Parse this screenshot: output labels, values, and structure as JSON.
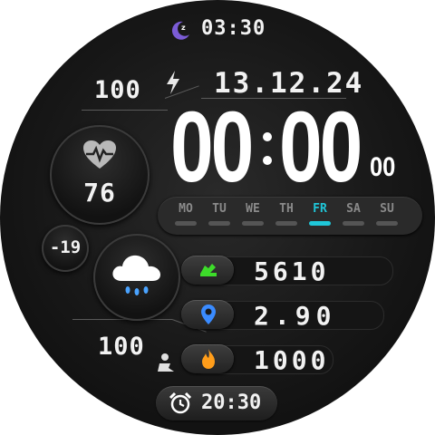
{
  "top": {
    "sleep_time": "03:30",
    "moon_color": "#7b5cd6"
  },
  "battery": {
    "value": "100"
  },
  "date": "13.12.24",
  "time": {
    "hours": "00",
    "minutes": "00",
    "seconds": "00"
  },
  "heart": {
    "value": "76"
  },
  "week": {
    "days": [
      "MO",
      "TU",
      "WE",
      "TH",
      "FR",
      "SA",
      "SU"
    ],
    "active_index": 4,
    "active_color": "#1fc6d8"
  },
  "weather": {
    "temp": "-19"
  },
  "stats": {
    "steps": {
      "value": "5610",
      "color": "#3ddc2a"
    },
    "distance": {
      "value": "2.90",
      "color": "#3a8bff"
    },
    "calories": {
      "value": "1000",
      "color": "#ff9d1a"
    }
  },
  "stand": {
    "value": "100"
  },
  "alarm": {
    "time": "20:30"
  }
}
